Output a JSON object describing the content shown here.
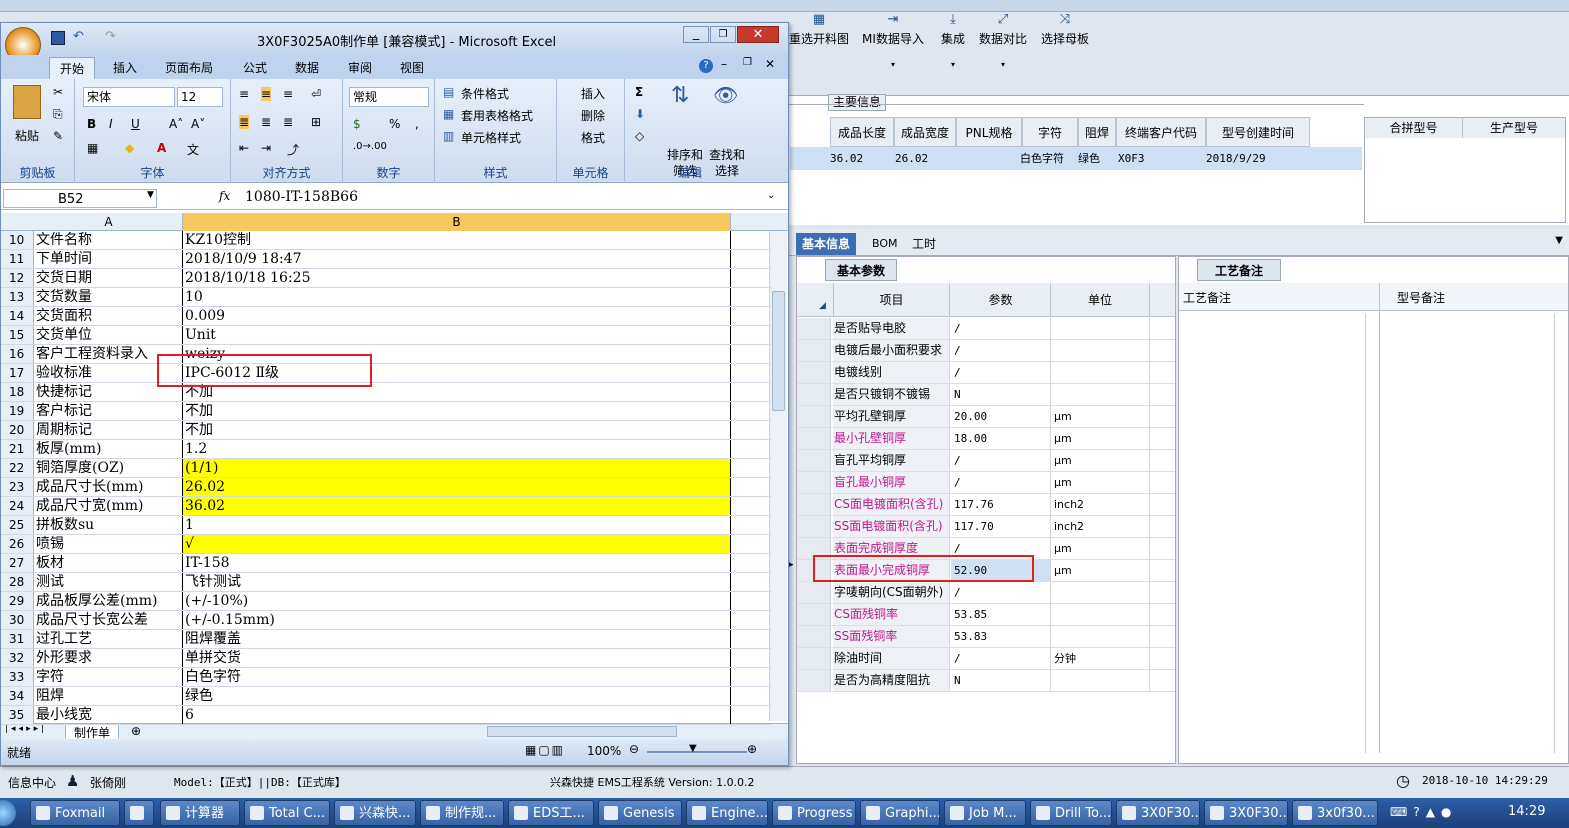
{
  "bg_app": {
    "toolbar": [
      {
        "label": "重选开料图",
        "icon": "image-icon"
      },
      {
        "label": "MI数据导入",
        "icon": "import-icon"
      },
      {
        "label": "集成",
        "icon": "download-icon"
      },
      {
        "label": "数据对比",
        "icon": "compare-icon"
      },
      {
        "label": "选择母板",
        "icon": "shuffle-icon"
      }
    ],
    "main_info_group": "主要信息",
    "main_headers": [
      "成品长度",
      "成品宽度",
      "PNL规格",
      "字符",
      "阻焊",
      "终端客户代码",
      "型号创建时间"
    ],
    "main_row": [
      "36.02",
      "26.02",
      "",
      "白色字符",
      "绿色",
      "X0F3",
      "2018/9/29"
    ],
    "side_headers": [
      "合拼型号",
      "生产型号"
    ],
    "tabs": [
      "基本信息",
      "BOM",
      "工时"
    ],
    "param_tab": "基本参数",
    "param_headers": [
      "项目",
      "参数",
      "单位"
    ],
    "params": [
      {
        "item": "是否贴导电胶",
        "value": "/",
        "unit": ""
      },
      {
        "item": "电镀后最小面积要求",
        "value": "/",
        "unit": ""
      },
      {
        "item": "电镀线别",
        "value": "/",
        "unit": ""
      },
      {
        "item": "是否只镀铜不镀锡",
        "value": "N",
        "unit": ""
      },
      {
        "item": "平均孔壁铜厚",
        "value": "20.00",
        "unit": "μm"
      },
      {
        "item": "最小孔壁铜厚",
        "value": "18.00",
        "unit": "μm"
      },
      {
        "item": "盲孔平均铜厚",
        "value": "/",
        "unit": "μm"
      },
      {
        "item": "盲孔最小铜厚",
        "value": "/",
        "unit": "μm"
      },
      {
        "item": "CS面电镀面积(含孔)",
        "value": "117.76",
        "unit": "inch2"
      },
      {
        "item": "SS面电镀面积(含孔)",
        "value": "117.70",
        "unit": "inch2"
      },
      {
        "item": "表面完成铜厚度",
        "value": "/",
        "unit": "μm"
      },
      {
        "item": "表面最小完成铜厚",
        "value": "52.90",
        "unit": "μm"
      },
      {
        "item": "字唛朝向(CS面朝外)",
        "value": "/",
        "unit": ""
      },
      {
        "item": "CS面残铜率",
        "value": "53.85",
        "unit": ""
      },
      {
        "item": "SS面残铜率",
        "value": "53.83",
        "unit": ""
      },
      {
        "item": "除油时间",
        "value": "/",
        "unit": "分钟"
      },
      {
        "item": "是否为高精度阻抗",
        "value": "N",
        "unit": ""
      }
    ],
    "craft_tab": "工艺备注",
    "craft_headers": [
      "工艺备注",
      "型号备注"
    ],
    "status": {
      "left": "信息中心",
      "user": "张倚刚",
      "model": "Model:【正式】||DB:【正式库】",
      "system": "兴森快捷 EMS工程系统 Version: 1.0.0.2",
      "datetime": "2018-10-10 14:29:29"
    }
  },
  "excel": {
    "title": "3X0F3025A0制作单 [兼容模式] - Microsoft Excel",
    "tabs": [
      "开始",
      "插入",
      "页面布局",
      "公式",
      "数据",
      "审阅",
      "视图"
    ],
    "font_name": "宋体",
    "font_size": "12",
    "number_format": "常规",
    "groups": [
      "剪贴板",
      "字体",
      "对齐方式",
      "数字",
      "样式",
      "单元格",
      "编辑"
    ],
    "paste": "粘贴",
    "style_btns": [
      "条件格式",
      "套用表格格式",
      "单元格样式"
    ],
    "cell_btns": [
      "插入",
      "删除",
      "格式"
    ],
    "edit_btns": [
      "排序和筛选",
      "查找和选择"
    ],
    "name_box": "B52",
    "formula": "1080-IT-158B66",
    "col_a": "A",
    "col_b": "B",
    "rows": [
      {
        "n": "10",
        "a": "文件名称",
        "b": "KZ10控制",
        "y": false
      },
      {
        "n": "11",
        "a": "下单时间",
        "b": "2018/10/9 18:47",
        "y": false
      },
      {
        "n": "12",
        "a": "交货日期",
        "b": "2018/10/18 16:25",
        "y": false
      },
      {
        "n": "13",
        "a": "交货数量",
        "b": "10",
        "y": false
      },
      {
        "n": "14",
        "a": "交货面积",
        "b": "0.009",
        "y": false
      },
      {
        "n": "15",
        "a": "交货单位",
        "b": "Unit",
        "y": false
      },
      {
        "n": "16",
        "a": "客户工程资料录入",
        "b": "weizy",
        "y": false
      },
      {
        "n": "17",
        "a": "验收标准",
        "b": "IPC-6012 Ⅱ级",
        "y": false
      },
      {
        "n": "18",
        "a": "快捷标记",
        "b": "不加",
        "y": false
      },
      {
        "n": "19",
        "a": "客户标记",
        "b": "不加",
        "y": false
      },
      {
        "n": "20",
        "a": "周期标记",
        "b": "不加",
        "y": false
      },
      {
        "n": "21",
        "a": "板厚(mm)",
        "b": "1.2",
        "y": false
      },
      {
        "n": "22",
        "a": "铜箔厚度(OZ)",
        "b": "(1/1)",
        "y": true
      },
      {
        "n": "23",
        "a": "成品尺寸长(mm)",
        "b": "26.02",
        "y": true
      },
      {
        "n": "24",
        "a": "成品尺寸宽(mm)",
        "b": "36.02",
        "y": true
      },
      {
        "n": "25",
        "a": "拼板数su",
        "b": "1",
        "y": false
      },
      {
        "n": "26",
        "a": "喷锡",
        "b": "√",
        "y": true
      },
      {
        "n": "27",
        "a": "板材",
        "b": "IT-158",
        "y": false
      },
      {
        "n": "28",
        "a": "测试",
        "b": "飞针测试",
        "y": false
      },
      {
        "n": "29",
        "a": "成品板厚公差(mm)",
        "b": "(+/-10%)",
        "y": false
      },
      {
        "n": "30",
        "a": "成品尺寸长宽公差",
        "b": "(+/-0.15mm)",
        "y": false
      },
      {
        "n": "31",
        "a": "过孔工艺",
        "b": "阻焊覆盖",
        "y": false
      },
      {
        "n": "32",
        "a": "外形要求",
        "b": "单拼交货",
        "y": false
      },
      {
        "n": "33",
        "a": "字符",
        "b": "白色字符",
        "y": false
      },
      {
        "n": "34",
        "a": "阻焊",
        "b": "绿色",
        "y": false
      },
      {
        "n": "35",
        "a": "最小线宽",
        "b": "6",
        "y": false
      }
    ],
    "sheet_tab": "制作单",
    "status_ready": "就绪",
    "zoom": "100%"
  },
  "taskbar": [
    "Foxmail",
    "",
    "计算器",
    "Total C...",
    "兴森快...",
    "制作规...",
    "EDS工...",
    "Genesis",
    "Engine...",
    "Progress",
    "Graphi...",
    "Job M...",
    "Drill To...",
    "3X0F30...",
    "3X0F30...",
    "3x0f30..."
  ],
  "clock": "14:29"
}
